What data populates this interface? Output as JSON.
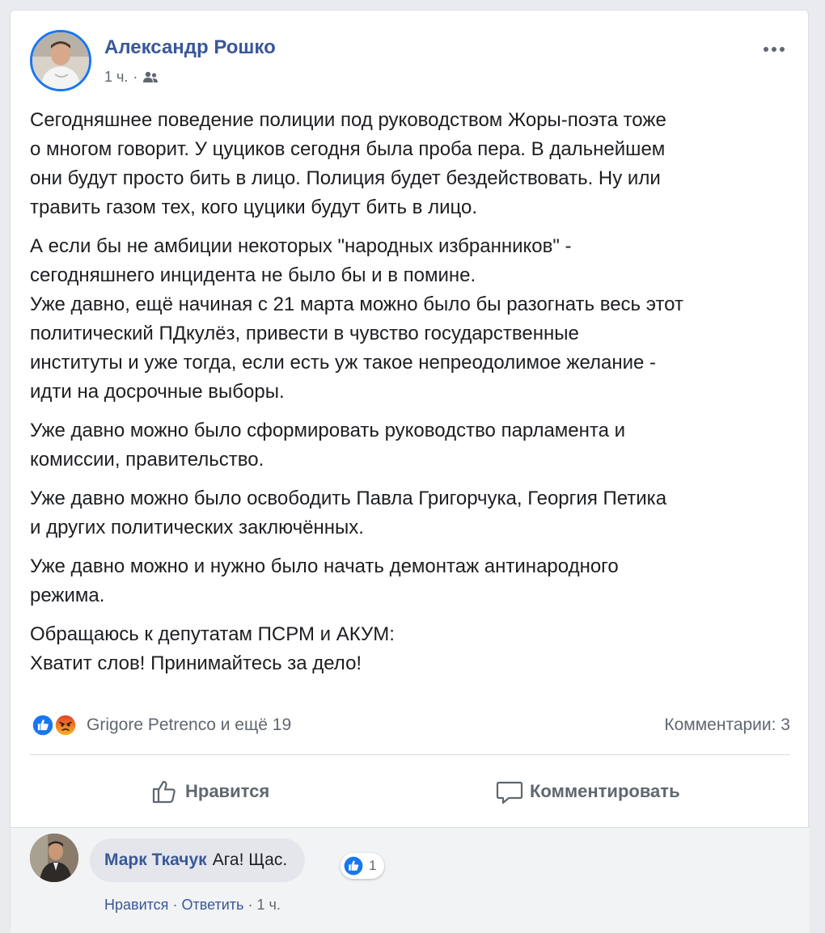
{
  "post": {
    "author": "Александр Рошко",
    "time": "1 ч.",
    "meta_separator": "·",
    "audience_icon": "friends-icon",
    "more_icon": "more-horizontal-icon",
    "paragraphs": [
      "Сегодняшнее поведение полиции под руководством Жоры-поэта тоже\nо многом говорит. У цуциков сегодня была проба пера. В дальнейшем\nони будут просто бить в лицо. Полиция будет бездействовать. Ну или\nтравить газом тех, кого цуцики будут бить в лицо.",
      "А если бы не амбиции некоторых \"народных избранников\" -\nсегодняшнего инцидента не было бы и в помине.\nУже давно, ещё начиная с 21 марта можно было бы разогнать весь этот\nполитический ПДкулёз, привести в чувство государственные\nинституты и уже тогда, если есть уж такое непреодолимое желание -\nидти на досрочные выборы.",
      "Уже давно можно было сформировать руководство парламента и\nкомиссии, правительство.",
      "Уже давно можно было освободить Павла Григорчука, Георгия Петика\nи других политических заключённых.",
      "Уже давно можно и нужно было начать демонтаж антинародного\nрежима.",
      "Обращаюсь к депутатам ПСРМ и АКУМ:\nХватит слов! Принимайтесь за дело!"
    ]
  },
  "reactions": {
    "icons": [
      "like-reaction-icon",
      "angry-reaction-icon"
    ],
    "text": "Grigore Petrenco и ещё 19",
    "comments_count": "Комментарии: 3"
  },
  "actions": {
    "like_label": "Нравится",
    "comment_label": "Комментировать"
  },
  "comment": {
    "author": "Марк Ткачук",
    "text": "Ага! Щас.",
    "reaction_count": "1",
    "like_label": "Нравится",
    "reply_label": "Ответить",
    "separator": "·",
    "time": "1 ч."
  },
  "colors": {
    "link_blue": "#385898",
    "facebook_blue": "#1877f2",
    "secondary_text": "#606770"
  }
}
